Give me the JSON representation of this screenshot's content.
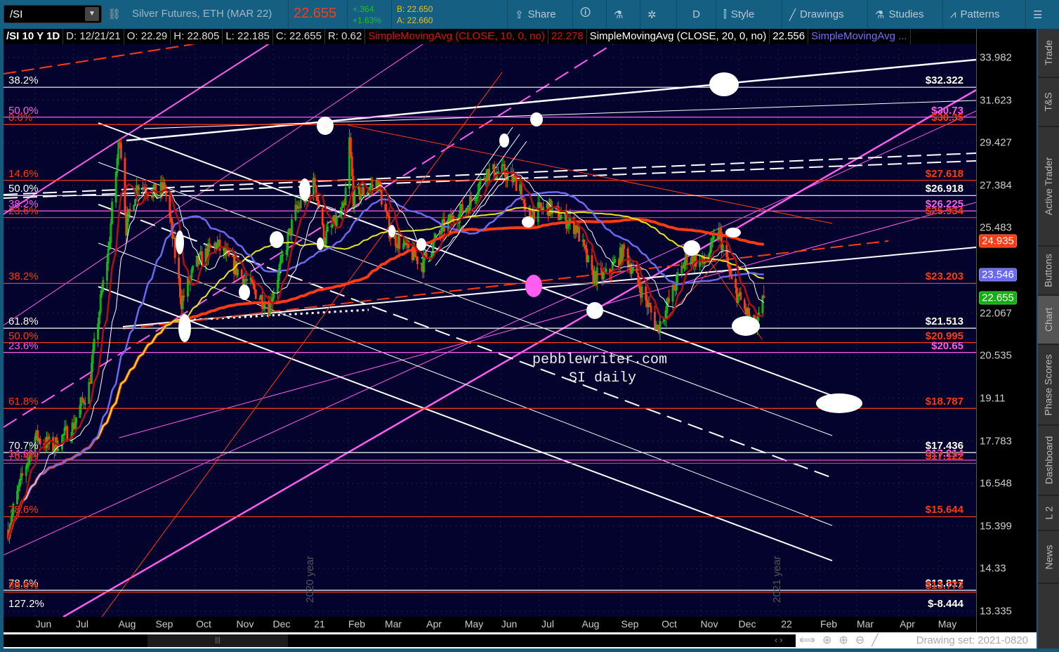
{
  "toolbar": {
    "symbol": "/SI",
    "description": "Silver Futures, ETH (MAR 22)",
    "last": "22.655",
    "change": "+.364",
    "change_pct": "+1.63%",
    "bid": "B: 22.650",
    "ask": "A: 22.660",
    "share": "Share",
    "period": "D",
    "style": "Style",
    "drawings": "Drawings",
    "studies": "Studies",
    "patterns": "Patterns"
  },
  "legend": {
    "title": "/SI 10 Y 1D",
    "date": "D: 12/21/21",
    "open": "O: 22.29",
    "high": "H: 22.805",
    "low": "L: 22.185",
    "close": "C: 22.655",
    "range": "R: 0.62",
    "study1": "SimpleMovingAvg (CLOSE, 10, 0, no)",
    "study1_val": "22.278",
    "study2": "SimpleMovingAvg (CLOSE, 20, 0, no)",
    "study2_val": "22.556",
    "study3": "SimpleMovingAvg ..."
  },
  "colors": {
    "red": "#ff3b14",
    "white": "#ffffff",
    "magenta": "#ff5cf0",
    "green": "#18c818",
    "blue": "#6a6af0",
    "yellow": "#e6e61e",
    "darkred": "#b01010"
  },
  "price_axis": {
    "ticks": [
      "33.982",
      "31.623",
      "29.427",
      "27.384",
      "25.483",
      "22.067",
      "20.535",
      "19.11",
      "17.783",
      "16.548",
      "15.399",
      "14.33",
      "13.335"
    ],
    "badges": [
      {
        "label": "24.935",
        "color": "#ff3b14"
      },
      {
        "label": "23.546",
        "color": "#6a6af0"
      },
      {
        "label": "22.655",
        "color": "#10b010"
      }
    ]
  },
  "time_axis": [
    "Jun",
    "Jul",
    "Aug",
    "Sep",
    "Oct",
    "Nov",
    "Dec",
    "21",
    "Feb",
    "Mar",
    "Apr",
    "May",
    "Jun",
    "Jul",
    "Aug",
    "Sep",
    "Oct",
    "Nov",
    "Dec",
    "22",
    "Feb",
    "Mar",
    "Apr",
    "May"
  ],
  "levels": [
    {
      "price": 32.322,
      "right": "$32.322",
      "left": "38.2%",
      "color": "white"
    },
    {
      "price": 30.73,
      "right": "$30.73",
      "left": "50.0%",
      "color": "magenta"
    },
    {
      "price": 30.35,
      "right": "$30.35",
      "left": "0.0%",
      "color": "red"
    },
    {
      "price": 27.618,
      "right": "$27.618",
      "left": "14.6%",
      "color": "red"
    },
    {
      "price": 26.918,
      "right": "$26.918",
      "left": "50.0%",
      "color": "white"
    },
    {
      "price": 26.225,
      "right": "$26.225",
      "left": "38.2%",
      "color": "magenta"
    },
    {
      "price": 25.934,
      "right": "$25.934",
      "left": "23.6%",
      "color": "red"
    },
    {
      "price": 23.203,
      "right": "$23.203",
      "left": "38.2%",
      "color": "red"
    },
    {
      "price": 21.513,
      "right": "$21.513",
      "left": "61.8%",
      "color": "white"
    },
    {
      "price": 20.995,
      "right": "$20.995",
      "left": "50.0%",
      "color": "red"
    },
    {
      "price": 20.65,
      "right": "$20.65",
      "left": "23.6%",
      "color": "magenta"
    },
    {
      "price": 18.787,
      "right": "$18.787",
      "left": "61.8%",
      "color": "red"
    },
    {
      "price": 17.436,
      "right": "$17.436",
      "left": "70.7%",
      "color": "white"
    },
    {
      "price": 17.214,
      "right": "$17.214",
      "left": "14.6%",
      "color": "magenta"
    },
    {
      "price": 17.122,
      "right": "$17.122",
      "left": "76.4%",
      "color": "red"
    },
    {
      "price": 15.644,
      "right": "$15.644",
      "left": "78.6%",
      "color": "red"
    },
    {
      "price": 13.817,
      "right": "$13.817",
      "left": "78.6%",
      "color": "white"
    },
    {
      "price": 13.773,
      "right": "$13.773",
      "left": "88.6%",
      "color": "red"
    },
    {
      "price": -8.444,
      "right": "$-8.444",
      "left": "127.2%",
      "color": "white"
    }
  ],
  "chart_data": {
    "type": "candlestick",
    "scale": "log",
    "ylim": [
      13.335,
      33.982
    ],
    "studies": [
      "SMA 10",
      "SMA 20",
      "SMA 50",
      "SMA 100",
      "SMA 200"
    ],
    "price_path": [
      [
        "2020-05-11",
        15.3
      ],
      [
        "2020-05-20",
        16.5
      ],
      [
        "2020-06-01",
        17.9
      ],
      [
        "2020-06-15",
        17.6
      ],
      [
        "2020-06-30",
        18.2
      ],
      [
        "2020-07-13",
        19.5
      ],
      [
        "2020-07-22",
        22.5
      ],
      [
        "2020-07-28",
        24.5
      ],
      [
        "2020-08-06",
        29.8
      ],
      [
        "2020-08-11",
        25.5
      ],
      [
        "2020-08-20",
        27.5
      ],
      [
        "2020-09-03",
        27.0
      ],
      [
        "2020-09-10",
        27.3
      ],
      [
        "2020-09-23",
        22.5
      ],
      [
        "2020-10-05",
        24.0
      ],
      [
        "2020-10-20",
        24.8
      ],
      [
        "2020-11-09",
        23.5
      ],
      [
        "2020-11-30",
        22.3
      ],
      [
        "2020-12-10",
        24.0
      ],
      [
        "2020-12-21",
        26.2
      ],
      [
        "2021-01-05",
        27.5
      ],
      [
        "2021-01-12",
        25.0
      ],
      [
        "2021-01-28",
        26.3
      ],
      [
        "2021-02-01",
        29.5
      ],
      [
        "2021-02-04",
        26.8
      ],
      [
        "2021-02-23",
        27.5
      ],
      [
        "2021-03-05",
        25.2
      ],
      [
        "2021-03-30",
        24.0
      ],
      [
        "2021-04-15",
        25.5
      ],
      [
        "2021-05-05",
        26.5
      ],
      [
        "2021-05-18",
        28.0
      ],
      [
        "2021-06-01",
        28.0
      ],
      [
        "2021-06-14",
        27.4
      ],
      [
        "2021-06-18",
        26.0
      ],
      [
        "2021-07-06",
        26.4
      ],
      [
        "2021-07-28",
        25.5
      ],
      [
        "2021-08-09",
        23.5
      ],
      [
        "2021-08-20",
        23.5
      ],
      [
        "2021-09-03",
        24.5
      ],
      [
        "2021-09-29",
        21.5
      ],
      [
        "2021-10-08",
        22.5
      ],
      [
        "2021-10-22",
        24.3
      ],
      [
        "2021-11-04",
        24.0
      ],
      [
        "2021-11-16",
        25.3
      ],
      [
        "2021-11-26",
        23.2
      ],
      [
        "2021-12-06",
        22.2
      ],
      [
        "2021-12-15",
        21.5
      ],
      [
        "2021-12-21",
        22.655
      ]
    ]
  },
  "watermark": {
    "line1": "pebblewriter.com",
    "line2": "SI daily",
    "year1": "2020 year",
    "year2": "2021 year"
  },
  "bottom": {
    "drawing_set": "Drawing set: 2021-0820"
  },
  "sidebar": [
    "Trade",
    "T&S",
    "Active Trader",
    "Buttons",
    "Chart",
    "Phase Scores",
    "Dashboard",
    "L 2",
    "News"
  ]
}
